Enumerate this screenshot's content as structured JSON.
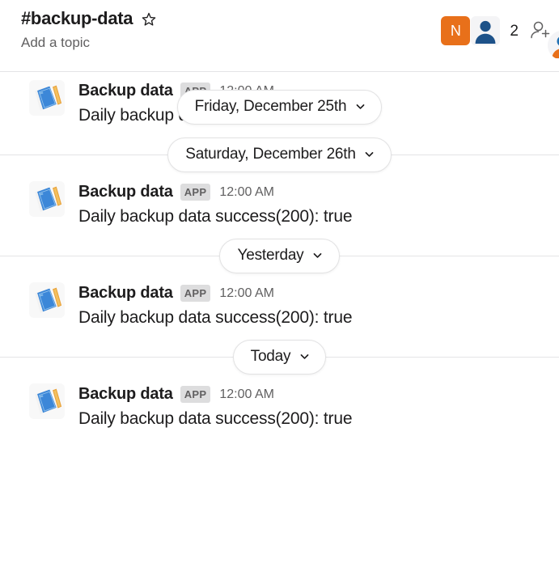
{
  "header": {
    "channel_name": "#backup-data",
    "topic_placeholder": "Add a topic",
    "star_icon": "star-outline-icon",
    "member_count": "2",
    "add_member_icon": "add-person-icon",
    "avatars": [
      {
        "type": "initial",
        "label": "N",
        "color": "#e8701a"
      },
      {
        "type": "person",
        "label": "",
        "color": "#1d5289"
      }
    ]
  },
  "messages": [
    {
      "sender": "Backup data",
      "badge": "APP",
      "time": "12:00 AM",
      "text": "Daily backup data success(200): true",
      "avatar_icon": "notebook-emoji"
    },
    {
      "sender": "Backup data",
      "badge": "APP",
      "time": "12:00 AM",
      "text": "Daily backup data success(200): true",
      "avatar_icon": "notebook-emoji"
    },
    {
      "sender": "Backup data",
      "badge": "APP",
      "time": "12:00 AM",
      "text": "Daily backup data success(200): true",
      "avatar_icon": "notebook-emoji"
    },
    {
      "sender": "Backup data",
      "badge": "APP",
      "time": "12:00 AM",
      "text": "Daily backup data success(200): true",
      "avatar_icon": "notebook-emoji"
    }
  ],
  "dividers": [
    {
      "label": "Friday, December 25th",
      "chevron": "chevron-down-icon"
    },
    {
      "label": "Saturday, December 26th",
      "chevron": "chevron-down-icon"
    },
    {
      "label": "Yesterday",
      "chevron": "chevron-down-icon"
    },
    {
      "label": "Today",
      "chevron": "chevron-down-icon"
    }
  ],
  "colors": {
    "accent_orange": "#e8701a",
    "avatar_blue": "#1d5289",
    "text_primary": "#1d1c1d",
    "text_secondary": "#616061",
    "border": "#e4e4e6",
    "badge_bg": "#ddddde"
  }
}
